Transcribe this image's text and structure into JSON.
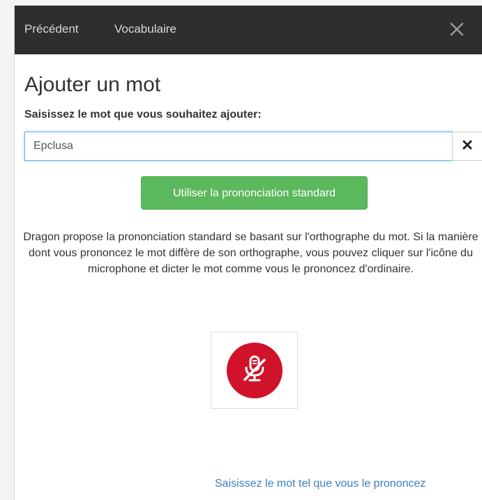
{
  "topbar": {
    "back_label": "Précédent",
    "vocab_label": "Vocabulaire",
    "close_icon": "close-icon",
    "background": "#2e2e2e"
  },
  "dialog": {
    "title": "Ajouter un mot",
    "field_label": "Saisissez le mot que vous souhaitez ajouter:",
    "word_value": "Epclusa",
    "clear_icon": "clear-x-icon",
    "standard_button_label": "Utiliser la prononciation standard",
    "help_text": "Dragon propose la prononciation standard se basant sur l'orthographe du mot. Si la manière dont vous prononcez le mot diffère de son orthographe, vous pouvez cliquer sur l'icône du microphone et dicter le mot comme vous le prononcez d'ordinaire.",
    "mic_icon": "microphone-off-icon",
    "pronounce_link": "Saisissez le mot tel que vous le prononcez"
  },
  "colors": {
    "accent_green": "#5cb85c",
    "mic_red": "#d0132a",
    "link_blue": "#3a7fc2"
  }
}
